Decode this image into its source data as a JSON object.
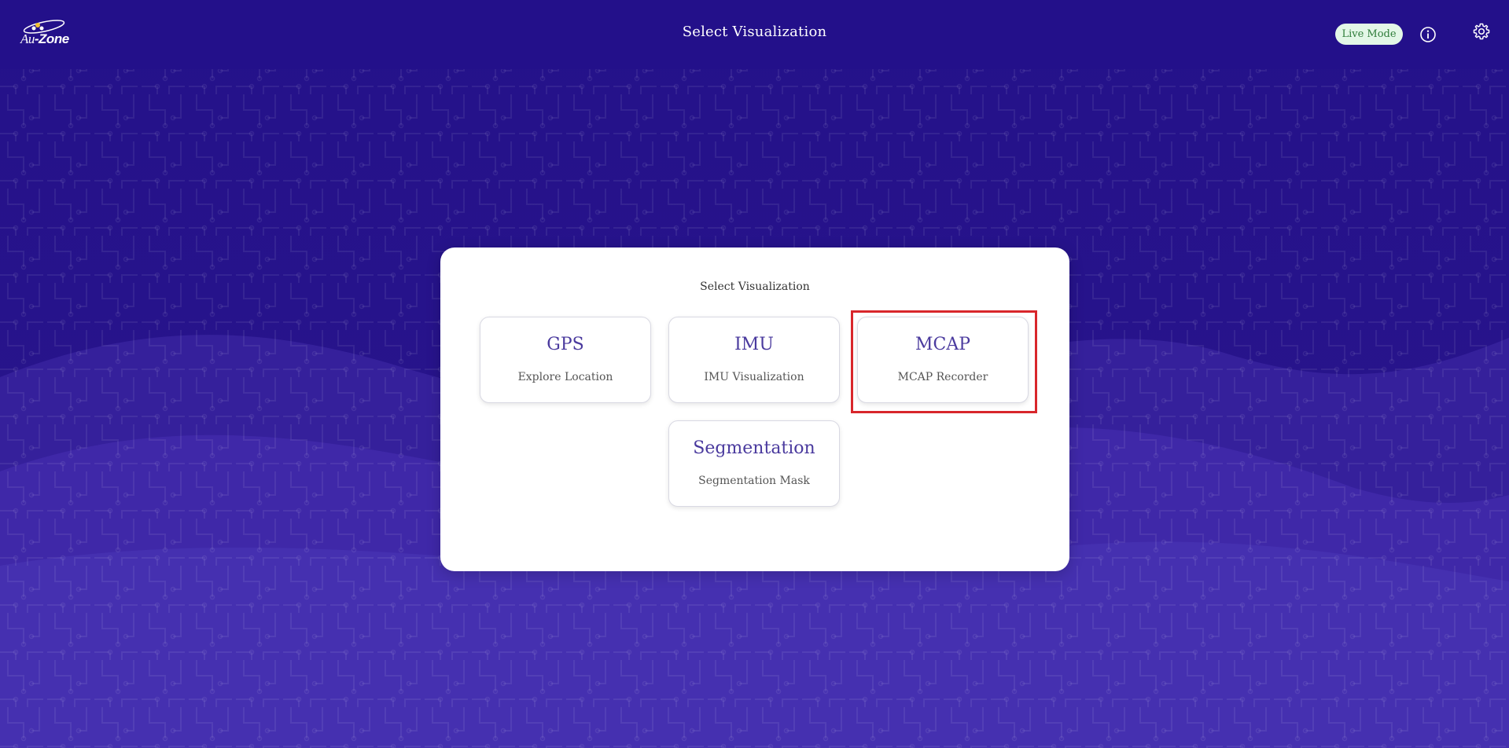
{
  "header": {
    "logo_text_au": "Au",
    "logo_text_zone": "-Zone",
    "title": "Select Visualization",
    "live_mode_label": "Live Mode",
    "info_icon": "info-icon",
    "settings_icon": "gear-icon"
  },
  "panel": {
    "title": "Select Visualization",
    "cards": [
      {
        "title": "GPS",
        "subtitle": "Explore Location"
      },
      {
        "title": "IMU",
        "subtitle": "IMU Visualization"
      },
      {
        "title": "MCAP",
        "subtitle": "MCAP Recorder"
      },
      {
        "title": "Segmentation",
        "subtitle": "Segmentation Mask"
      }
    ]
  },
  "colors": {
    "header_bg": "#23108a",
    "background": "#2a1a8c",
    "card_title": "#4a3a9e",
    "live_mode_bg": "#e3f7e7",
    "live_mode_text": "#2f7d3a",
    "highlight_border": "#d8262b"
  }
}
